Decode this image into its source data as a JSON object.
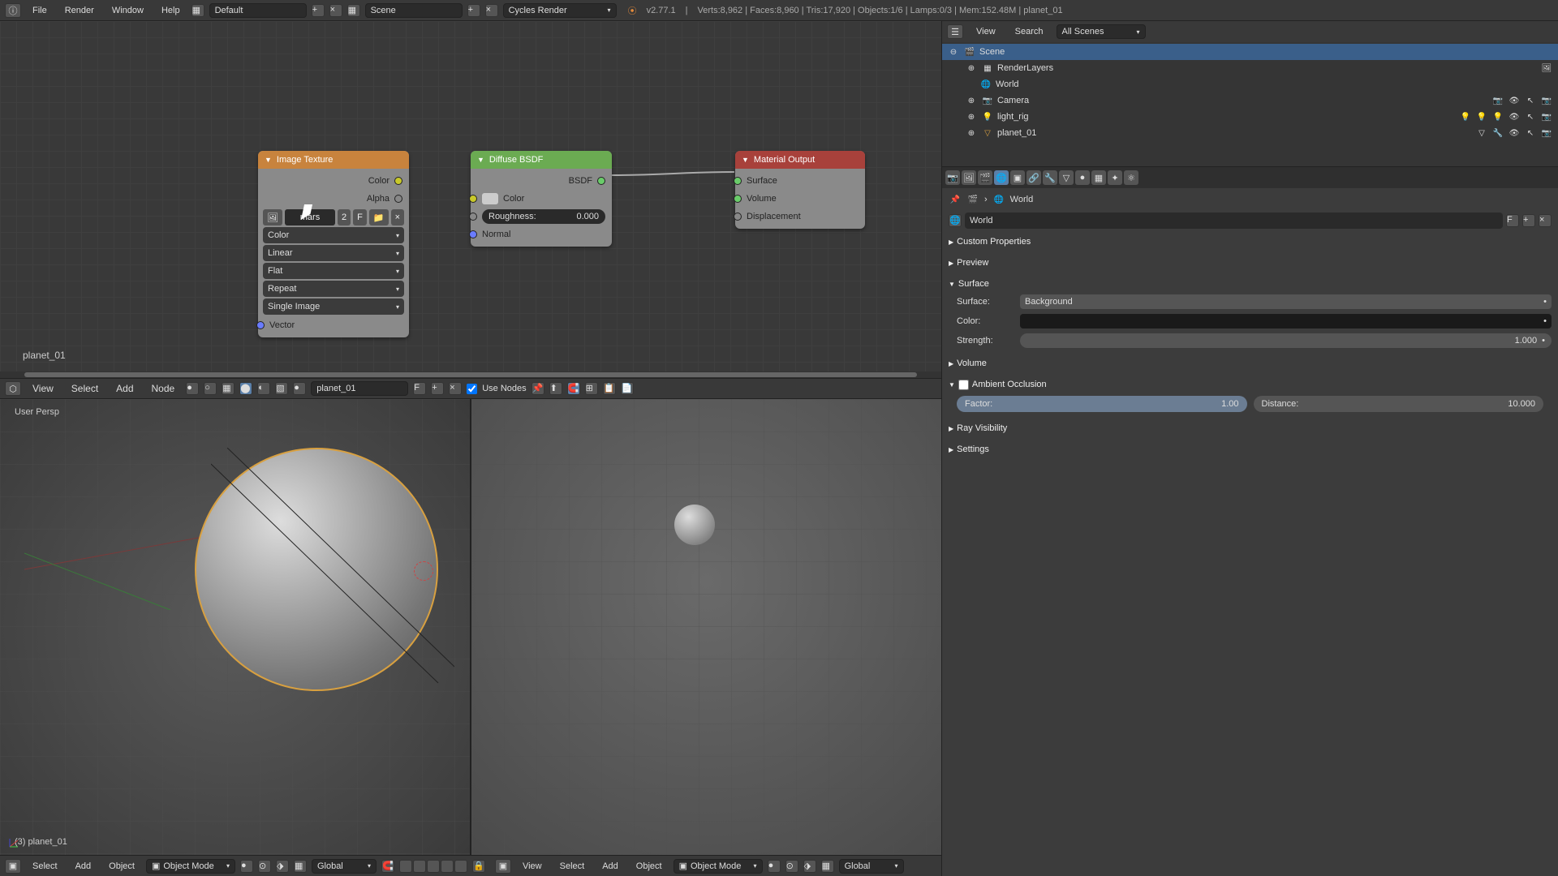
{
  "topbar": {
    "menus": [
      "File",
      "Render",
      "Window",
      "Help"
    ],
    "layout": "Default",
    "scene": "Scene",
    "engine": "Cycles Render",
    "version": "v2.77.1",
    "stats": "Verts:8,962 | Faces:8,960 | Tris:17,920 | Objects:1/6 | Lamps:0/3 | Mem:152.48M | planet_01"
  },
  "node_editor": {
    "object_label": "planet_01",
    "nodes": {
      "img_tex": {
        "title": "Image Texture",
        "out_color": "Color",
        "out_alpha": "Alpha",
        "image_name": "mars",
        "image_users": "2",
        "fake_user": "F",
        "dd_color": "Color",
        "dd_interp": "Linear",
        "dd_proj": "Flat",
        "dd_ext": "Repeat",
        "dd_src": "Single Image",
        "in_vector": "Vector"
      },
      "diffuse": {
        "title": "Diffuse BSDF",
        "out_bsdf": "BSDF",
        "in_color": "Color",
        "roughness_label": "Roughness:",
        "roughness_value": "0.000",
        "in_normal": "Normal"
      },
      "mat_out": {
        "title": "Material Output",
        "in_surface": "Surface",
        "in_volume": "Volume",
        "in_disp": "Displacement"
      }
    },
    "bar_menus": [
      "View",
      "Select",
      "Add",
      "Node"
    ],
    "material_name": "planet_01",
    "fake_user": "F",
    "use_nodes": "Use Nodes"
  },
  "view3d": {
    "persp": "User Persp",
    "object_count": "(3) planet_01",
    "bar_menus": [
      "Select",
      "Add",
      "Object"
    ],
    "right_bar_menus": [
      "View",
      "Select",
      "Add",
      "Object"
    ],
    "mode": "Object Mode",
    "orientation": "Global"
  },
  "outliner": {
    "hdr": {
      "view": "View",
      "search": "Search",
      "filter": "All Scenes"
    },
    "items": [
      {
        "label": "Scene",
        "depth": 0
      },
      {
        "label": "RenderLayers",
        "depth": 1
      },
      {
        "label": "World",
        "depth": 1
      },
      {
        "label": "Camera",
        "depth": 1
      },
      {
        "label": "light_rig",
        "depth": 1
      },
      {
        "label": "planet_01",
        "depth": 1
      }
    ]
  },
  "props": {
    "breadcrumb": "World",
    "datablock": "World",
    "fake_user": "F",
    "panels": {
      "custom_props": "Custom Properties",
      "preview": "Preview",
      "surface": "Surface",
      "volume": "Volume",
      "ao": "Ambient Occlusion",
      "ray_vis": "Ray Visibility",
      "settings": "Settings"
    },
    "surface_row": {
      "label": "Surface:",
      "value": "Background"
    },
    "color_row": {
      "label": "Color:"
    },
    "strength_row": {
      "label": "Strength:",
      "value": "1.000"
    },
    "ao_factor": {
      "label": "Factor:",
      "value": "1.00"
    },
    "ao_distance": {
      "label": "Distance:",
      "value": "10.000"
    }
  }
}
